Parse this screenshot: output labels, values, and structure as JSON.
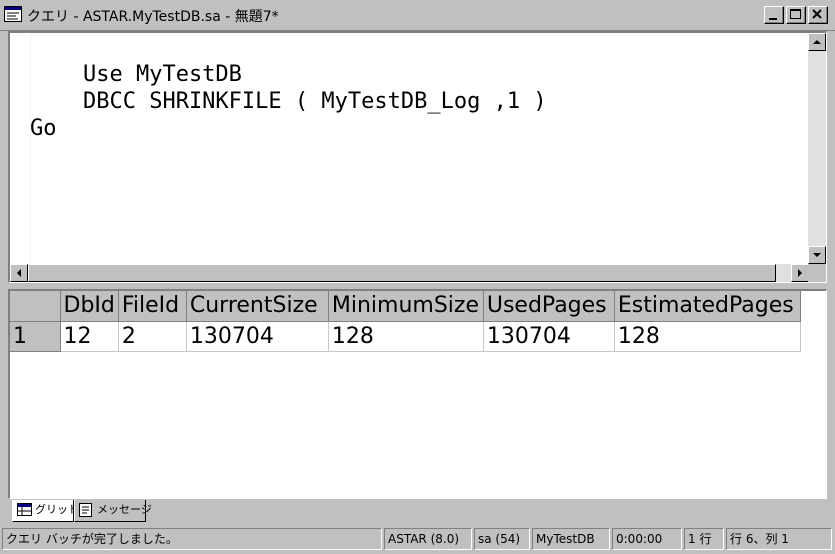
{
  "window": {
    "title": "クエリ - ASTAR.MyTestDB.sa - 無題7*"
  },
  "editor": {
    "code": "    Use MyTestDB\n    DBCC SHRINKFILE ( MyTestDB_Log ,1 )\nGo"
  },
  "results": {
    "columns": [
      "DbId",
      "FileId",
      "CurrentSize",
      "MinimumSize",
      "UsedPages",
      "EstimatedPages"
    ],
    "rows": [
      {
        "num": "1",
        "cells": [
          "12",
          "2",
          "130704",
          "128",
          "130704",
          "128"
        ]
      }
    ]
  },
  "tabs": [
    {
      "label": "グリッド",
      "icon": "grid-icon",
      "active": true
    },
    {
      "label": "メッセージ",
      "icon": "message-icon",
      "active": false
    }
  ],
  "status": {
    "message": "クエリ バッチが完了しました。",
    "server": "ASTAR (8.0)",
    "user": "sa (54)",
    "database": "MyTestDB",
    "elapsed": "0:00:00",
    "rows": "1 行",
    "position": "行 6、列 1"
  }
}
